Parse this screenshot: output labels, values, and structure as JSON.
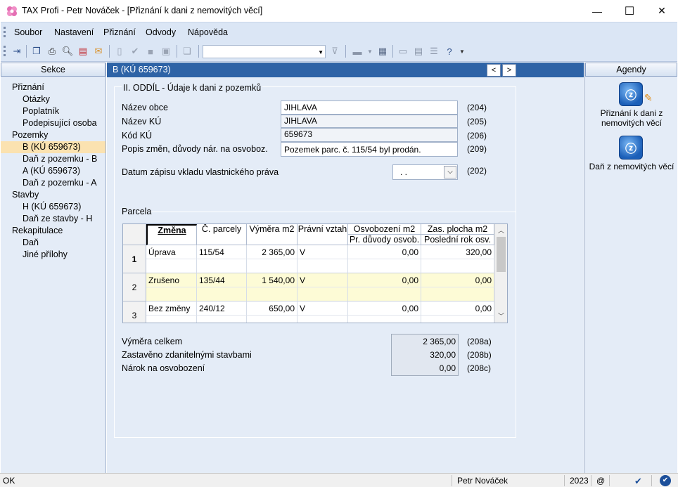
{
  "window": {
    "title": "TAX Profi - Petr Nováček - [Přiznání k dani z nemovitých věcí]",
    "minimize": "—",
    "maximize": "☐",
    "close": "✕"
  },
  "menu": [
    {
      "label": "Soubor"
    },
    {
      "label": "Nastavení"
    },
    {
      "label": "Přiznání"
    },
    {
      "label": "Odvody"
    },
    {
      "label": "Nápověda"
    }
  ],
  "toolbar": {
    "combo_value": ""
  },
  "left_panel": {
    "title": "Sekce",
    "items": [
      {
        "label": "Přiznání",
        "level": 0
      },
      {
        "label": "Otázky",
        "level": 1
      },
      {
        "label": "Poplatník",
        "level": 1
      },
      {
        "label": "Podepisující osoba",
        "level": 1
      },
      {
        "label": "Pozemky",
        "level": 0
      },
      {
        "label": "B  (KÚ 659673)",
        "level": 1,
        "selected": true
      },
      {
        "label": "Daň z pozemku - B",
        "level": 1
      },
      {
        "label": "A  (KÚ 659673)",
        "level": 1
      },
      {
        "label": "Daň z pozemku - A",
        "level": 1
      },
      {
        "label": "Stavby",
        "level": 0
      },
      {
        "label": "H  (KÚ 659673)",
        "level": 1
      },
      {
        "label": "Daň ze stavby - H",
        "level": 1
      },
      {
        "label": "Rekapitulace",
        "level": 0
      },
      {
        "label": "Daň",
        "level": 1
      },
      {
        "label": "Jiné přílohy",
        "level": 1
      }
    ]
  },
  "center": {
    "header": "B  (KÚ 659673)",
    "nav_prev": "<",
    "nav_next": ">",
    "section_title": "II. ODDÍL - Údaje k dani z pozemků",
    "fields": [
      {
        "label": "Název obce",
        "value": "JIHLAVA",
        "code": "(204)"
      },
      {
        "label": "Název KÚ",
        "value": "JIHLAVA",
        "code": "(205)"
      },
      {
        "label": "Kód KÚ",
        "value": "659673",
        "code": "(206)"
      },
      {
        "label": "Popis změn, důvody nár. na osvoboz.",
        "value": "Pozemek parc. č. 115/54 byl prodán.",
        "code": "(209)"
      }
    ],
    "date_field": {
      "label": "Datum zápisu vkladu vlastnického práva",
      "value": " .  .",
      "code": "(202)"
    },
    "parcela_title": "Parcela",
    "grid": {
      "headers_top": [
        "Změna",
        "Č. parcely",
        "Výměra m2",
        "Právní vztah",
        "Osvobození m2",
        "Zas. plocha m2"
      ],
      "headers_bottom": [
        "Pr. důvody osvob.",
        "Poslední rok osv."
      ],
      "rows": [
        {
          "num": "1",
          "zmena": "Úprava",
          "parcela": "115/54",
          "vymera": "2 365,00",
          "vztah": "V",
          "osvob": "0,00",
          "zas": "320,00"
        },
        {
          "num": "2",
          "zmena": "Zrušeno",
          "parcela": "135/44",
          "vymera": "1 540,00",
          "vztah": "V",
          "osvob": "0,00",
          "zas": "0,00"
        },
        {
          "num": "3",
          "zmena": "Bez změny",
          "parcela": "240/12",
          "vymera": "650,00",
          "vztah": "V",
          "osvob": "0,00",
          "zas": "0,00"
        }
      ]
    },
    "summary": [
      {
        "label": "Výměra celkem",
        "value": "2 365,00",
        "code": "(208a)"
      },
      {
        "label": "Zastavěno zdanitelnými stavbami",
        "value": "320,00",
        "code": "(208b)"
      },
      {
        "label": "Nárok na osvobození",
        "value": "0,00",
        "code": "(208c)"
      }
    ]
  },
  "right_panel": {
    "title": "Agendy",
    "items": [
      {
        "label": "Přiznání k dani z nemovitých věcí"
      },
      {
        "label": "Daň z nemovitých věcí"
      }
    ]
  },
  "statusbar": {
    "left": "OK",
    "user": "Petr Nováček",
    "year": "2023",
    "at": "@"
  }
}
